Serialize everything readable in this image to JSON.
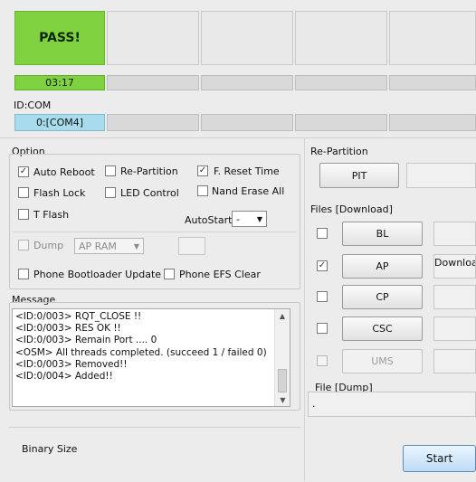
{
  "status": {
    "result": "PASS!",
    "elapsed_time": "03:17"
  },
  "com": {
    "label": "ID:COM",
    "port": "0:[COM4]"
  },
  "option": {
    "title": "Option",
    "auto_reboot": {
      "label": "Auto Reboot",
      "checked": true
    },
    "re_partition": {
      "label": "Re-Partition",
      "checked": false
    },
    "f_reset_time": {
      "label": "F. Reset Time",
      "checked": true
    },
    "flash_lock": {
      "label": "Flash Lock",
      "checked": false
    },
    "led_control": {
      "label": "LED Control",
      "checked": false
    },
    "nand_erase_all": {
      "label": "Nand Erase All",
      "checked": false
    },
    "t_flash": {
      "label": "T Flash",
      "checked": false
    },
    "autostart_label": "AutoStart",
    "autostart_value": "-",
    "dump": {
      "label": "Dump",
      "checked": false
    },
    "dump_target": "AP RAM",
    "phone_bootloader_update": {
      "label": "Phone Bootloader Update",
      "checked": false
    },
    "phone_efs_clear": {
      "label": "Phone EFS Clear",
      "checked": false
    }
  },
  "message": {
    "title": "Message",
    "lines": [
      "<ID:0/003> RQT_CLOSE !!",
      "<ID:0/003> RES OK !!",
      "<ID:0/003> Remain Port ....  0",
      "<OSM> All threads completed. (succeed 1 / failed 0)",
      "<ID:0/003> Removed!!",
      "<ID:0/004> Added!!"
    ]
  },
  "binary_size_label": "Binary Size",
  "repartition": {
    "title": "Re-Partition",
    "pit_label": "PIT"
  },
  "files": {
    "title": "Files [Download]",
    "items": [
      {
        "label": "BL",
        "checked": false,
        "path": "",
        "enabled": true
      },
      {
        "label": "AP",
        "checked": true,
        "path": "Download",
        "enabled": true
      },
      {
        "label": "CP",
        "checked": false,
        "path": "",
        "enabled": true
      },
      {
        "label": "CSC",
        "checked": false,
        "path": "",
        "enabled": true
      },
      {
        "label": "UMS",
        "checked": false,
        "path": "",
        "enabled": false
      }
    ]
  },
  "file_dump": {
    "title": "File [Dump]",
    "value": "."
  },
  "start_label": "Start"
}
